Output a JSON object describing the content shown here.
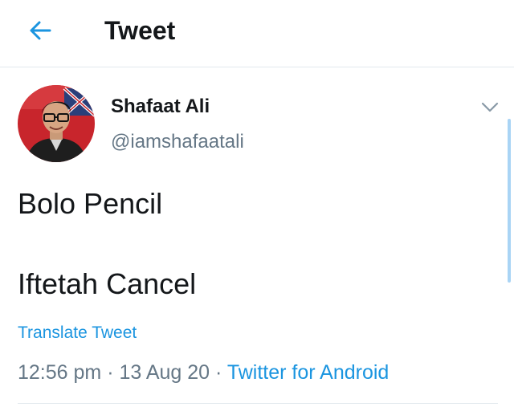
{
  "header": {
    "back_icon": "arrow-left-icon",
    "title": "Tweet"
  },
  "tweet": {
    "author": {
      "name": "Shafaat Ali",
      "handle": "@iamshafaatali",
      "avatar": "avatar-photo"
    },
    "menu_icon": "chevron-down-icon",
    "lines": [
      "Bolo Pencil",
      "Iftetah Cancel"
    ],
    "translate_label": "Translate Tweet",
    "time": "12:56 pm",
    "date": "13 Aug 20",
    "separator": " · ",
    "source": "Twitter for Android"
  },
  "colors": {
    "accent": "#1b95e0",
    "text": "#14171a",
    "secondary": "#657786",
    "border": "#e1e8ed"
  }
}
